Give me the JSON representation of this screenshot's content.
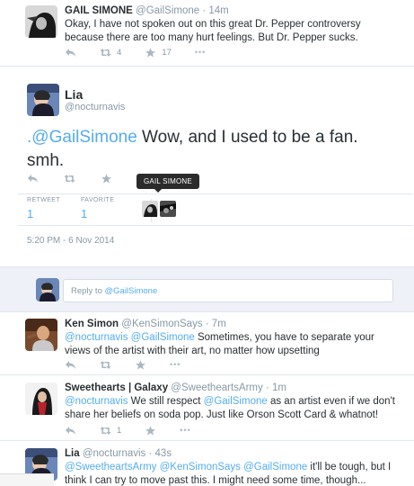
{
  "tweets_top": {
    "name": "GAIL SIMONE",
    "handle": "@GailSimone",
    "time": "· 14m",
    "text": "Okay, I have not spoken out on this great Dr. Pepper controversy because there are too many hurt feelings. But Dr. Pepper sucks.",
    "retweets": "4",
    "favorites": "17"
  },
  "focused": {
    "name": "Lia",
    "handle": "@nocturnavis",
    "mention": ".@GailSimone",
    "text": " Wow, and I used to be a fan. smh.",
    "tooltip": "GAIL SIMONE",
    "retweet_label": "RETWEET",
    "retweet_count": "1",
    "favorite_label": "FAVORITE",
    "favorite_count": "1",
    "timestamp": "5:20 PM - 6 Nov 2014"
  },
  "reply": {
    "prefix": "Reply to ",
    "target": "@GailSimone"
  },
  "replies": [
    {
      "name": "Ken Simon",
      "handle": "@KenSimonSays",
      "time": "· 7m",
      "mentions": "@nocturnavis @GailSimone",
      "text": " Sometimes, you have to separate your views of the artist with their art, no matter how upsetting"
    },
    {
      "name": "Sweethearts | Galaxy",
      "handle": "@SweetheartsArmy",
      "time": "· 1m",
      "mention1": "@nocturnavis",
      "text1": " We still respect ",
      "mention2": "@GailSimone",
      "text2": " as an artist even if we don't share her beliefs on soda pop. Just like Orson Scott Card & whatnot!",
      "retweets": "1"
    },
    {
      "name": "Lia",
      "handle": "@nocturnavis",
      "time": "· 43s",
      "mentions": "@SweetheartsArmy @KenSimonSays @GailSimone",
      "text": " it'll be tough, but I think I can try to move past this. I might need some time, though..."
    }
  ],
  "more_label": "•••",
  "colors": {
    "link": "#55acee",
    "muted": "#8899a6",
    "reply_bg": "#eef2f8"
  }
}
